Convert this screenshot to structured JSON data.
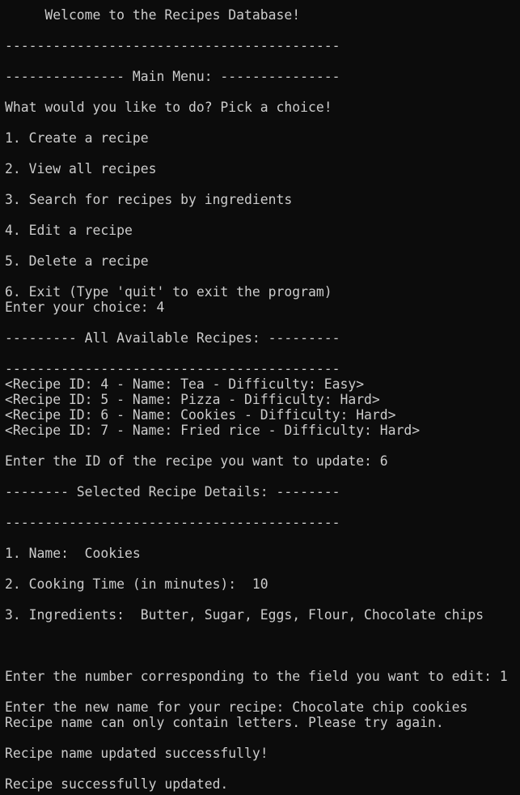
{
  "terminal": {
    "background": "#0c0c0c",
    "foreground": "#cccccc",
    "lines": [
      {
        "role": "banner",
        "text": "     Welcome to the Recipes Database!"
      },
      {
        "role": "separator",
        "text": "------------------------------------------"
      },
      {
        "role": "heading",
        "text": "--------------- Main Menu: ---------------"
      },
      {
        "role": "prompt",
        "text": "What would you like to do? Pick a choice!"
      },
      {
        "role": "menu-option",
        "text": "1. Create a recipe"
      },
      {
        "role": "menu-option",
        "text": "2. View all recipes"
      },
      {
        "role": "menu-option",
        "text": "3. Search for recipes by ingredients"
      },
      {
        "role": "menu-option",
        "text": "4. Edit a recipe"
      },
      {
        "role": "menu-option",
        "text": "5. Delete a recipe"
      },
      {
        "role": "menu-option",
        "text": "6. Exit (Type 'quit' to exit the program)"
      },
      {
        "role": "input",
        "text": "Enter your choice: 4"
      },
      {
        "role": "heading",
        "text": "--------- All Available Recipes: ---------"
      },
      {
        "role": "separator",
        "text": "------------------------------------------"
      },
      {
        "role": "recipe-entry",
        "text": "<Recipe ID: 4 - Name: Tea - Difficulty: Easy>"
      },
      {
        "role": "recipe-entry",
        "text": "<Recipe ID: 5 - Name: Pizza - Difficulty: Hard>"
      },
      {
        "role": "recipe-entry",
        "text": "<Recipe ID: 6 - Name: Cookies - Difficulty: Hard>"
      },
      {
        "role": "recipe-entry",
        "text": "<Recipe ID: 7 - Name: Fried rice - Difficulty: Hard>"
      },
      {
        "role": "input",
        "text": "Enter the ID of the recipe you want to update: 6"
      },
      {
        "role": "heading",
        "text": "-------- Selected Recipe Details: --------"
      },
      {
        "role": "separator",
        "text": "------------------------------------------"
      },
      {
        "role": "detail-field",
        "text": "1. Name:  Cookies"
      },
      {
        "role": "detail-field",
        "text": "2. Cooking Time (in minutes):  10"
      },
      {
        "role": "detail-field",
        "text": "3. Ingredients:  Butter, Sugar, Eggs, Flour, Chocolate chips"
      },
      {
        "role": "input",
        "text": "Enter the number corresponding to the field you want to edit: 1"
      },
      {
        "role": "input",
        "text": "Enter the new name for your recipe: Chocolate chip cookies"
      },
      {
        "role": "error-message",
        "text": "Recipe name can only contain letters. Please try again."
      },
      {
        "role": "success-message",
        "text": "Recipe name updated successfully!"
      },
      {
        "role": "success-message",
        "text": "Recipe successfully updated."
      }
    ]
  }
}
